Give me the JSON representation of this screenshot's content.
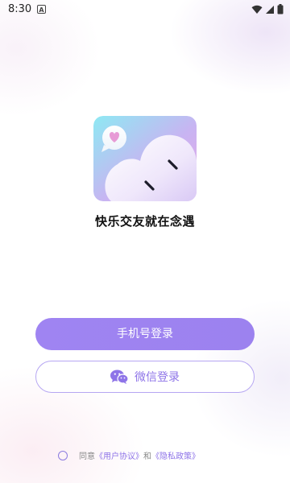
{
  "status_bar": {
    "time": "8:30",
    "notification_letter": "A",
    "icons": [
      "wifi-icon",
      "signal-icon",
      "battery-icon"
    ]
  },
  "app": {
    "title": "快乐交友就在念遇"
  },
  "buttons": {
    "phone_login": "手机号登录",
    "wechat_login": "微信登录"
  },
  "agreement": {
    "prefix": "同意",
    "user_agreement": "《用户协议》",
    "conjunction": "和",
    "privacy_policy": "《隐私政策》"
  },
  "colors": {
    "accent": "#9c82ef",
    "link": "#8e74e8"
  }
}
